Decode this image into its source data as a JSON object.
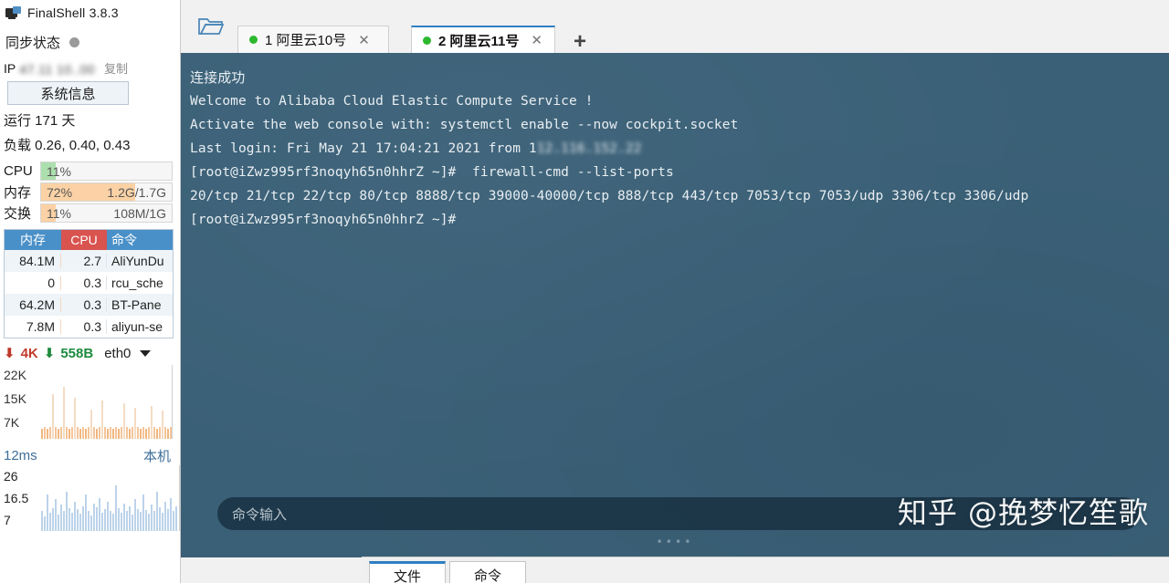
{
  "app": {
    "title": "FinalShell 3.8.3",
    "icon": "monitor-icon"
  },
  "sidebar": {
    "sync": {
      "label": "同步状态",
      "status_icon": "status-dot"
    },
    "ip": {
      "label": "IP",
      "value": "47.11  10..00",
      "copy_label": "复制"
    },
    "sysinfo_button": "系统信息",
    "uptime": "运行 171 天",
    "load": "负载 0.26, 0.40, 0.43",
    "meters": [
      {
        "name": "CPU",
        "percent": "11%",
        "percent_value": 11,
        "detail": "",
        "color": "#addfae"
      },
      {
        "name": "内存",
        "percent": "72%",
        "percent_value": 72,
        "detail": "1.2G/1.7G",
        "color": "#fbd2a5"
      },
      {
        "name": "交换",
        "percent": "11%",
        "percent_value": 11,
        "detail": "108M/1G",
        "color": "#fbd2a5"
      }
    ],
    "process_table": {
      "headers": [
        "内存",
        "CPU",
        "命令"
      ],
      "rows": [
        {
          "mem": "84.1M",
          "cpu": "2.7",
          "cmd": "AliYunDu"
        },
        {
          "mem": "0",
          "cpu": "0.3",
          "cmd": "rcu_sche"
        },
        {
          "mem": "64.2M",
          "cpu": "0.3",
          "cmd": "BT-Pane"
        },
        {
          "mem": "7.8M",
          "cpu": "0.3",
          "cmd": "aliyun-se"
        }
      ]
    },
    "network": {
      "up_icon": "arrow-up-icon",
      "up": "4K",
      "down_icon": "arrow-down-icon",
      "down": "558B",
      "interface": "eth0",
      "dropdown_icon": "chevron-down-icon",
      "y_labels": [
        "22K",
        "15K",
        "7K"
      ]
    },
    "latency": {
      "value": "12ms",
      "host": "本机",
      "y_labels": [
        "26",
        "16.5",
        "7"
      ]
    }
  },
  "bottom_tabs": [
    {
      "label": "文件",
      "active": true
    },
    {
      "label": "命令",
      "active": false
    }
  ],
  "tabstrip": {
    "folder_icon": "folder-open-icon",
    "add_icon": "plus-icon",
    "tabs": [
      {
        "index": "1",
        "label": "1  阿里云10号",
        "active": false,
        "status_icon": "green-dot",
        "close_icon": "close-icon"
      },
      {
        "index": "2",
        "label": "2  阿里云11号",
        "active": true,
        "status_icon": "green-dot",
        "close_icon": "close-icon"
      }
    ]
  },
  "terminal": {
    "background_color": "#3a6077",
    "lines": [
      {
        "text": "连接成功",
        "cn": true,
        "blur": false
      },
      {
        "text": "",
        "cn": false,
        "blur": false
      },
      {
        "text": "Welcome to Alibaba Cloud Elastic Compute Service !",
        "cn": false,
        "blur": false
      },
      {
        "text": "",
        "cn": false,
        "blur": false
      },
      {
        "text": "Activate the web console with: systemctl enable --now cockpit.socket",
        "cn": false,
        "blur": false
      },
      {
        "text": "",
        "cn": false,
        "blur": false
      },
      {
        "text": "Last login: Fri May 21 17:04:21 2021 from 1",
        "cn": false,
        "blur": false,
        "suffix_blurred": "12.116.152.22"
      },
      {
        "text": "[root@iZwz995rf3noqyh65n0hhrZ ~]#  firewall-cmd --list-ports",
        "cn": false,
        "blur": false
      },
      {
        "text": "20/tcp 21/tcp 22/tcp 80/tcp 8888/tcp 39000-40000/tcp 888/tcp 443/tcp 7053/tcp 7053/udp 3306/tcp 3306/udp",
        "cn": false,
        "blur": false
      },
      {
        "text": "[root@iZwz995rf3noqyh65n0hhrZ ~]#",
        "cn": false,
        "blur": false
      }
    ],
    "command_input_placeholder": "命令输入",
    "watermark": "知乎 @挽梦忆笙歌"
  }
}
